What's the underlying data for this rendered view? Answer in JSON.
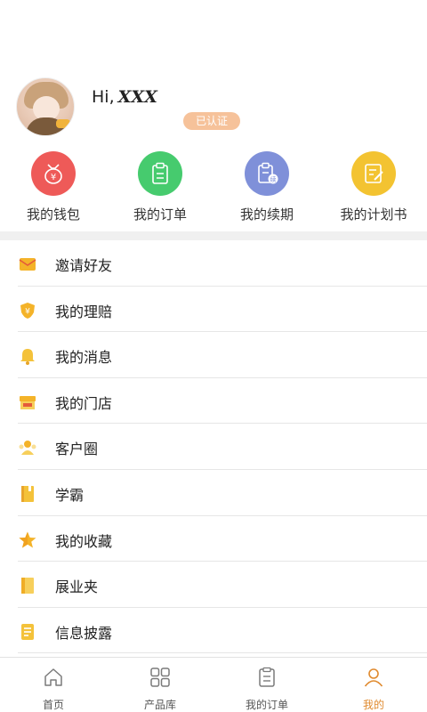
{
  "profile": {
    "greeting": "Hi,",
    "username": "XXX",
    "verified_badge": "已认证"
  },
  "quick_actions": [
    {
      "label": "我的钱包",
      "icon": "wallet-icon",
      "color": "#ee5a58"
    },
    {
      "label": "我的订单",
      "icon": "order-icon",
      "color": "#46cb6e"
    },
    {
      "label": "我的续期",
      "icon": "renewal-icon",
      "color": "#7f90d9"
    },
    {
      "label": "我的计划书",
      "icon": "plan-icon",
      "color": "#f3c331"
    }
  ],
  "menu": [
    {
      "label": "邀请好友",
      "icon": "envelope-icon"
    },
    {
      "label": "我的理赔",
      "icon": "shield-icon"
    },
    {
      "label": "我的消息",
      "icon": "bell-icon"
    },
    {
      "label": "我的门店",
      "icon": "store-icon"
    },
    {
      "label": "客户圈",
      "icon": "people-icon"
    },
    {
      "label": "学霸",
      "icon": "book-icon"
    },
    {
      "label": "我的收藏",
      "icon": "star-icon"
    },
    {
      "label": "展业夹",
      "icon": "folder-icon"
    },
    {
      "label": "信息披露",
      "icon": "document-icon"
    }
  ],
  "tabbar": {
    "items": [
      {
        "label": "首页",
        "icon": "home-icon"
      },
      {
        "label": "产品库",
        "icon": "grid-icon"
      },
      {
        "label": "我的订单",
        "icon": "clipboard-icon"
      },
      {
        "label": "我的",
        "icon": "user-icon"
      }
    ],
    "active_index": 3
  },
  "colors": {
    "accent": "#e08a2e",
    "badge": "#f6c29a",
    "menu_icon": "#f4b329"
  }
}
